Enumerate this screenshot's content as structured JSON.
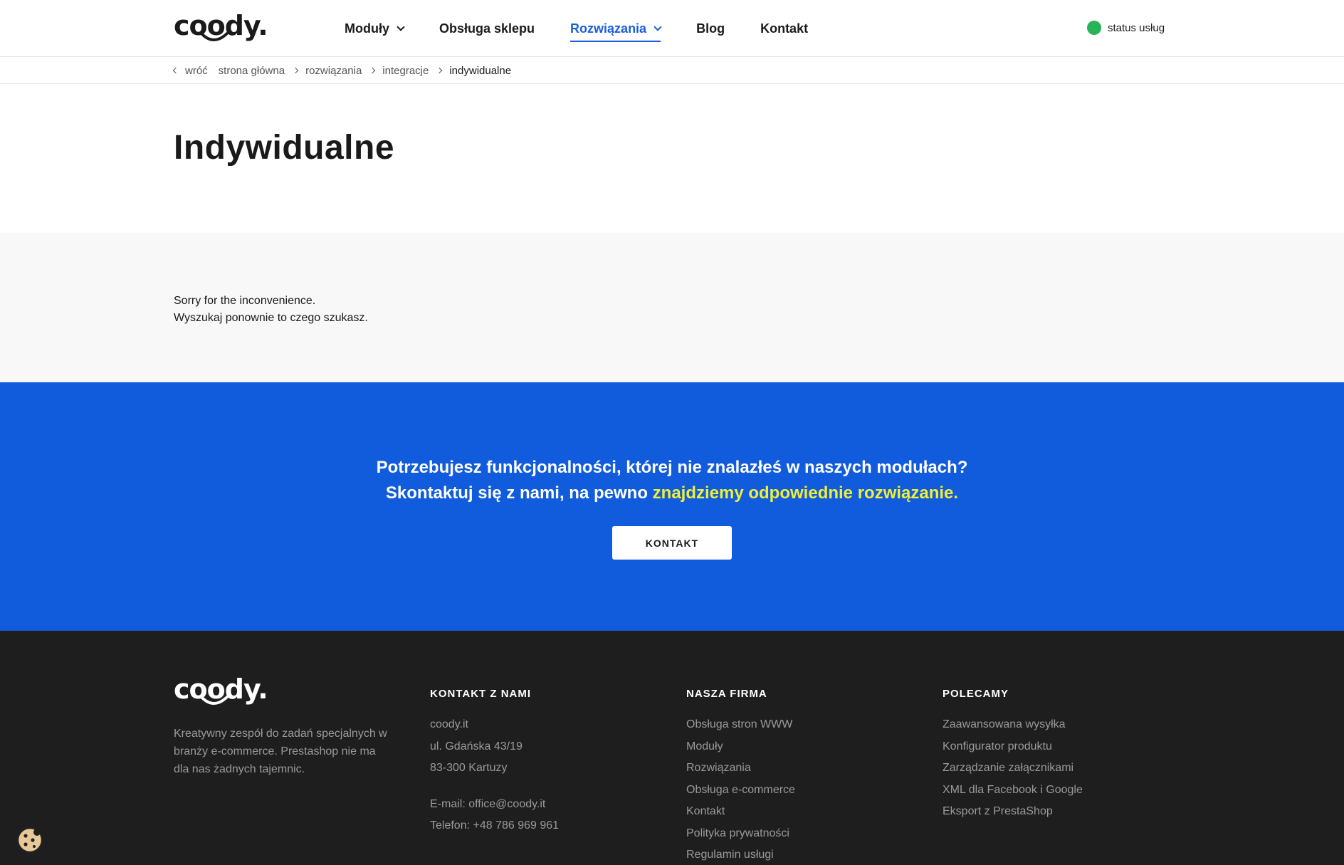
{
  "header": {
    "logo": "coody.",
    "nav": [
      {
        "label": "Moduły"
      },
      {
        "label": "Obsługa sklepu"
      },
      {
        "label": "Rozwiązania"
      },
      {
        "label": "Blog"
      },
      {
        "label": "Kontakt"
      }
    ],
    "status_label": "status usług",
    "colors": {
      "accent": "#1b5fd9",
      "status": "#27b35a"
    }
  },
  "breadcrumb": {
    "back": "wróć",
    "items": [
      "strona główna",
      "rozwiązania",
      "integracje",
      "indywidualne"
    ]
  },
  "page": {
    "title": "Indywidualne",
    "message_line1": "Sorry for the inconvenience.",
    "message_line2": "Wyszukaj ponownie to czego szukasz."
  },
  "cta": {
    "line1": "Potrzebujesz funkcjonalności, której nie znalazłeś w naszych modułach?",
    "line2_plain": "Skontaktuj się z nami, na pewno ",
    "line2_highlight": "znajdziemy odpowiednie rozwiązanie.",
    "button": "KONTAKT",
    "colors": {
      "background": "#115bdd",
      "highlight": "#f0ef37"
    }
  },
  "footer": {
    "logo": "coody.",
    "description": "Kreatywny zespół do zadań specjalnych w branży e-commerce. Prestashop nie ma dla nas żadnych tajemnic.",
    "contact": {
      "heading": "KONTAKT Z NAMI",
      "lines": [
        "coody.it",
        "ul. Gdańska 43/19",
        "83-300 Kartuzy"
      ],
      "email": "E-mail: office@coody.it",
      "phone": "Telefon: +48 786 969 961"
    },
    "company": {
      "heading": "NASZA FIRMA",
      "links": [
        "Obsługa stron WWW",
        "Moduły",
        "Rozwiązania",
        "Obsługa e-commerce",
        "Kontakt",
        "Polityka prywatności",
        "Regulamin usługi"
      ]
    },
    "recommend": {
      "heading": "POLECAMY",
      "links": [
        "Zaawansowana wysyłka",
        "Konfigurator produktu",
        "Zarządzanie załącznikami",
        "XML dla Facebook i Google",
        "Eksport z PrestaShop"
      ]
    }
  }
}
